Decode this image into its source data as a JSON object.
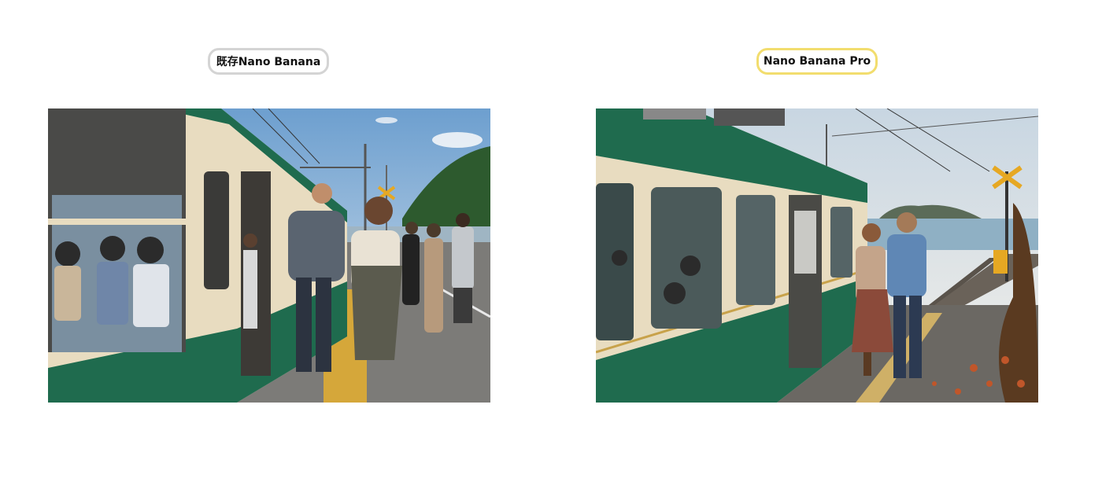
{
  "left_panel": {
    "label": "既存Nano Banana"
  },
  "right_panel": {
    "label": "Nano Banana Pro"
  },
  "colors": {
    "left_border": "#d4d4d4",
    "right_border": "#f2dd6e",
    "train_green": "#1f6b4e",
    "train_cream": "#e8dcc0"
  }
}
